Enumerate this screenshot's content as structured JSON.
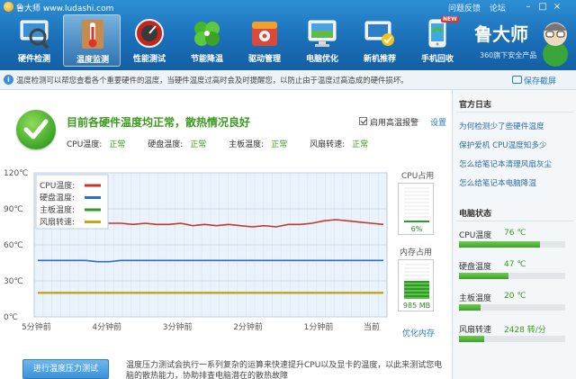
{
  "app": {
    "title": "鲁大师 www.ludashi.com",
    "top_links": [
      "问题反馈",
      "论坛"
    ],
    "window_controls": [
      "minimize-icon",
      "maximize-icon",
      "close-icon"
    ],
    "brand_name": "鲁大师",
    "brand_sub": "360旗下安全产品",
    "new_badge": "NEW"
  },
  "nav": {
    "active_index": 1,
    "items": [
      {
        "label": "硬件检测",
        "icon": "hardware-check-icon"
      },
      {
        "label": "温度监测",
        "icon": "thermometer-icon"
      },
      {
        "label": "性能测试",
        "icon": "speedometer-icon"
      },
      {
        "label": "节能降温",
        "icon": "leaf-icon"
      },
      {
        "label": "驱动管理",
        "icon": "driver-icon"
      },
      {
        "label": "电脑优化",
        "icon": "optimize-icon"
      },
      {
        "label": "新机推荐",
        "icon": "new-pc-icon"
      },
      {
        "label": "手机回收",
        "icon": "phone-icon"
      }
    ]
  },
  "infobar": {
    "text": "温度检测可以帮您查看各个重要硬件的温度，当硬件温度过高时会及时提醒您，以防止由于温度过高造成的硬件损坏。",
    "save_label": "保存截屏"
  },
  "status": {
    "headline": "目前各硬件温度均正常，散热情况良好",
    "items": [
      {
        "label": "CPU温度:",
        "value": "正常"
      },
      {
        "label": "硬盘温度:",
        "value": "正常"
      },
      {
        "label": "主板温度:",
        "value": "正常"
      },
      {
        "label": "风扇转速:",
        "value": "正常"
      }
    ],
    "alarm_label": "启用高温报警",
    "settings_label": "设置"
  },
  "chart_data": {
    "type": "line",
    "y_ticks": [
      "120℃",
      "90℃",
      "60℃",
      "30℃",
      "0℃"
    ],
    "ylim": [
      0,
      120
    ],
    "x_ticks": [
      "5分钟前",
      "4分钟前",
      "3分钟前",
      "2分钟前",
      "1分钟前",
      "当前"
    ],
    "grid": true,
    "legend_position": "top-left",
    "series": [
      {
        "name": "CPU温度:",
        "color": "#c0392b",
        "values": [
          82,
          82,
          81,
          80,
          78,
          79,
          78,
          78,
          77,
          78,
          77,
          77,
          78,
          76,
          77,
          76,
          77,
          76,
          75,
          76,
          75,
          77,
          77,
          78,
          80,
          81,
          80,
          79,
          78,
          77
        ]
      },
      {
        "name": "硬盘温度:",
        "color": "#2f6fc2",
        "values": [
          47,
          47,
          47,
          47,
          47,
          46,
          46,
          47,
          47,
          47,
          47,
          47,
          47,
          47,
          47,
          47,
          47,
          47,
          47,
          47,
          47,
          47,
          47,
          47,
          47,
          47,
          47,
          47,
          47,
          47
        ]
      },
      {
        "name": "主板温度:",
        "color": "#2f9a2a",
        "values": [
          20,
          20,
          20,
          20,
          20,
          20,
          20,
          20,
          20,
          20,
          20,
          20,
          20,
          20,
          20,
          20,
          20,
          20,
          20,
          20,
          20,
          20,
          20,
          20,
          20,
          20,
          20,
          20,
          20,
          20
        ]
      },
      {
        "name": "风扇转速:",
        "color": "#d4a017",
        "values": [
          20,
          20,
          20,
          20,
          20,
          20,
          20,
          20,
          20,
          20,
          20,
          20,
          20,
          20,
          20,
          20,
          20,
          20,
          20,
          20,
          20,
          20,
          20,
          20,
          20,
          20,
          20,
          20,
          20,
          20
        ]
      }
    ]
  },
  "meters": {
    "cpu_label": "CPU占用",
    "cpu_value": "6%",
    "cpu_fraction": 0.06,
    "mem_label": "内存占用",
    "mem_value": "985 MB",
    "mem_fraction": 0.5,
    "optimize_label": "优化内存"
  },
  "actions": {
    "test_button": "进行温度压力测试",
    "description": "温度压力测试会执行一系列复杂的运算来快速提升CPU以及显卡的温度，以此来测试您电脑的散热能力，协助排查电脑潜在的散热故障"
  },
  "right": {
    "log_title": "官方日志",
    "logs": [
      "为何检测少了些硬件温度",
      "保护爱机 CPU温度知多少",
      "怎么给笔记本清理风扇灰尘",
      "怎么给笔记本电脑降温"
    ],
    "state_title": "电脑状态",
    "states": [
      {
        "label": "CPU温度",
        "value": "76 ℃",
        "fraction": 0.76
      },
      {
        "label": "硬盘温度",
        "value": "47 ℃",
        "fraction": 0.47
      },
      {
        "label": "主板温度",
        "value": "20 ℃",
        "fraction": 0.2
      },
      {
        "label": "风扇转速",
        "value": "2428 转/分",
        "fraction": 0.24
      }
    ]
  }
}
